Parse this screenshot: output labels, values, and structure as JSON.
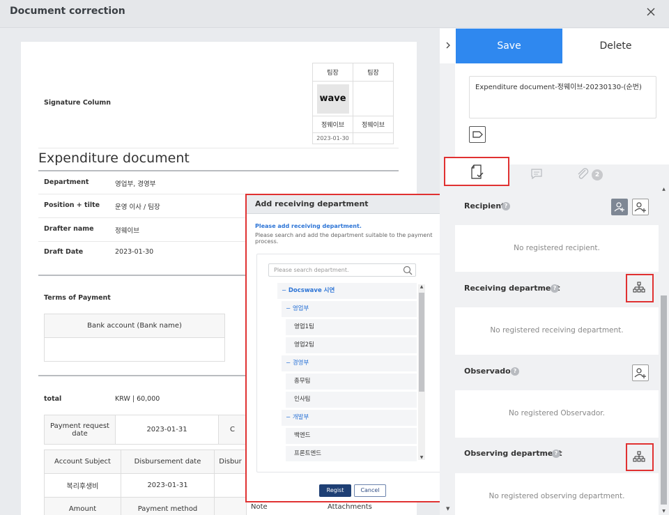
{
  "window": {
    "title": "Document correction"
  },
  "document": {
    "signature_label": "Signature Column",
    "signature": {
      "headers": [
        "팀장",
        "팀장"
      ],
      "logo_text": "wave",
      "names": [
        "정웨이브",
        "정웨이브"
      ],
      "date": "2023-01-30"
    },
    "title": "Expenditure document",
    "fields": [
      {
        "label": "Department",
        "value": "영업부, 경영부"
      },
      {
        "label": "Position + tilte",
        "value": "운영 이사 / 팀장"
      },
      {
        "label": "Drafter name",
        "value": "정웨이브"
      },
      {
        "label": "Draft Date",
        "value": "2023-01-30"
      }
    ],
    "terms_label": "Terms of Payment",
    "bank_header": "Bank account (Bank name)",
    "total_label": "total",
    "total_value": "KRW | 60,000",
    "payment_request_label": "Payment request date",
    "payment_request_value": "2023-01-31",
    "payment_request_extra": "C",
    "account_headers": [
      "Account Subject",
      "Disbursement date",
      "Disbur"
    ],
    "account_row": [
      "복리후생비",
      "2023-01-31",
      ""
    ],
    "bottom_headers": [
      "Amount",
      "Payment method",
      "Note",
      "Attachments"
    ]
  },
  "modal": {
    "title": "Add receiving department",
    "info_title": "Please add receiving department.",
    "info_desc": "Please search and add the department suitable to the payment process.",
    "search_placeholder": "Please search department.",
    "tree": [
      {
        "label": "Docswave 시연",
        "type": "group",
        "level": 0
      },
      {
        "label": "영업부",
        "type": "group",
        "level": 1
      },
      {
        "label": "영업1팀",
        "type": "leaf",
        "level": 2
      },
      {
        "label": "영업2팀",
        "type": "leaf",
        "level": 2
      },
      {
        "label": "경영부",
        "type": "group",
        "level": 1
      },
      {
        "label": "총무팀",
        "type": "leaf",
        "level": 2
      },
      {
        "label": "인사팀",
        "type": "leaf",
        "level": 2
      },
      {
        "label": "개발부",
        "type": "group",
        "level": 1
      },
      {
        "label": "백엔드",
        "type": "leaf",
        "level": 2
      },
      {
        "label": "프론트엔드",
        "type": "leaf",
        "level": 2
      }
    ],
    "regist_label": "Regist",
    "cancel_label": "Cancel"
  },
  "panel": {
    "save_label": "Save",
    "delete_label": "Delete",
    "subject": "Expenditure document-정웨이브-20230130-(순번)",
    "attach_count": "2",
    "sections": {
      "recipient": {
        "label": "Recipient",
        "empty": "No registered recipient."
      },
      "receiving": {
        "label": "Receiving department",
        "empty": "No registered receiving department."
      },
      "observador": {
        "label": "Observador",
        "empty": "No registered Observador."
      },
      "observing": {
        "label": "Observing department",
        "empty": "No registered observing department."
      }
    }
  },
  "colors": {
    "accent": "#2f88ef",
    "highlight": "#e03131",
    "modal_primary": "#1e3f74",
    "link": "#2c74d6"
  }
}
